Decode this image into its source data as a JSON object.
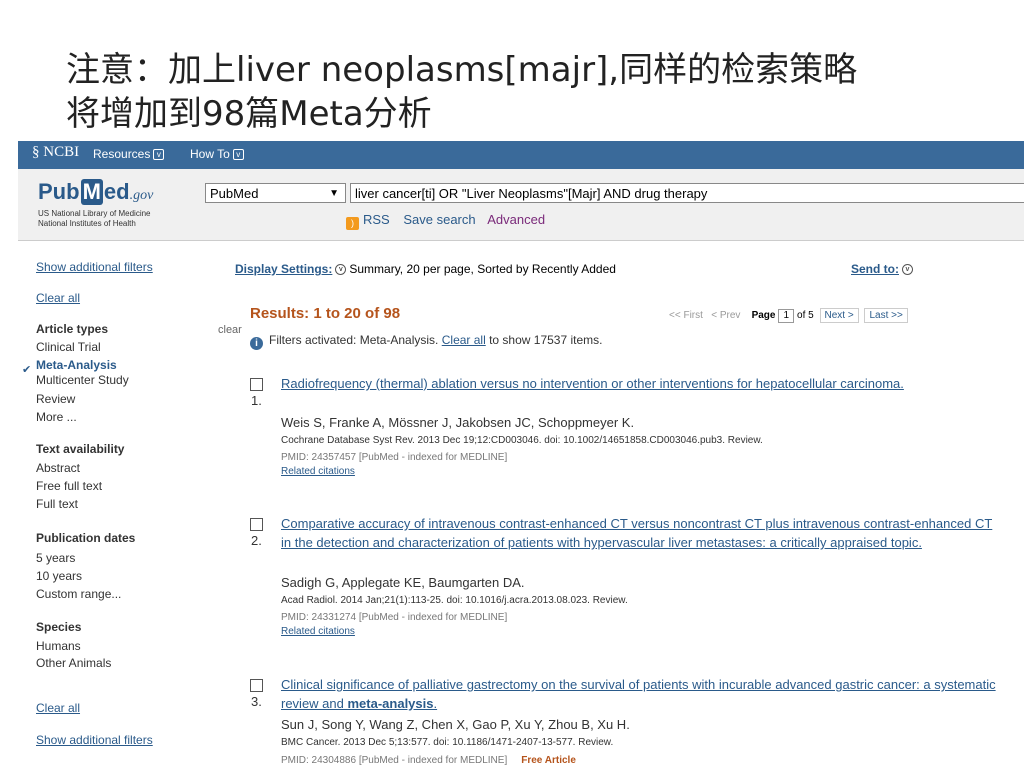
{
  "slide": {
    "title_line1": "注意：加上liver neoplasms[majr],同样的检索策略",
    "title_line2": "将增加到98篇Meta分析"
  },
  "ncbi_bar": {
    "logo": "NCBI",
    "resources": "Resources",
    "howto": "How To"
  },
  "pubmed": {
    "logo_pub": "Pub",
    "logo_m": "M",
    "logo_ed": "ed",
    "logo_gov": ".gov",
    "nlm_line1": "US National Library of Medicine",
    "nlm_line2": "National Institutes of Health",
    "db_selected": "PubMed",
    "query": "liver cancer[ti] OR \"Liver Neoplasms\"[Majr] AND drug therapy",
    "rss": "RSS",
    "save_search": "Save search",
    "advanced": "Advanced"
  },
  "sidebar": {
    "show_filters_top": "Show additional filters",
    "clear_all_top": "Clear all",
    "article_types": "Article types",
    "clear": "clear",
    "types": [
      "Clinical Trial",
      "Meta-Analysis",
      "Multicenter Study",
      "Review",
      "More ..."
    ],
    "text_availability": "Text availability",
    "text_items": [
      "Abstract",
      "Free full text",
      "Full text"
    ],
    "pub_dates": "Publication dates",
    "date_items": [
      "5 years",
      "10 years",
      "Custom range..."
    ],
    "species": "Species",
    "species_items": [
      "Humans",
      "Other Animals"
    ],
    "clear_all_bottom": "Clear all",
    "show_filters_bottom": "Show additional filters"
  },
  "main": {
    "display_settings": "Display Settings:",
    "display_value": "Summary, 20 per page, Sorted by Recently Added",
    "send_to": "Send to:",
    "results": "Results: 1 to 20 of 98",
    "first": "<< First",
    "prev": "< Prev",
    "page_label": "Page",
    "page_value": "1",
    "of_pages": "of 5",
    "next": "Next >",
    "last": "Last >>",
    "filters_text": "Filters activated: Meta-Analysis.",
    "clear_all": "Clear all",
    "filters_tail": "to show 17537 items."
  },
  "results": [
    {
      "num": "1.",
      "title": "Radiofrequency (thermal) ablation versus no intervention or other interventions for hepatocellular carcinoma.",
      "authors": "Weis S, Franke A, Mössner J, Jakobsen JC, Schoppmeyer K.",
      "cite": "Cochrane Database Syst Rev. 2013 Dec 19;12:CD003046. doi: 10.1002/14651858.CD003046.pub3. Review.",
      "pmid": "PMID: 24357457 [PubMed - indexed for MEDLINE]",
      "related": "Related citations"
    },
    {
      "num": "2.",
      "title": "Comparative accuracy of intravenous contrast-enhanced CT versus noncontrast CT plus intravenous contrast-enhanced CT in the detection and characterization of patients with hypervascular liver metastases: a critically appraised topic.",
      "authors": "Sadigh G, Applegate KE, Baumgarten DA.",
      "cite": "Acad Radiol. 2014 Jan;21(1):113-25. doi: 10.1016/j.acra.2013.08.023. Review.",
      "pmid": "PMID: 24331274 [PubMed - indexed for MEDLINE]",
      "related": "Related citations"
    },
    {
      "num": "3.",
      "title_a": "Clinical significance of palliative gastrectomy on the survival of patients with incurable advanced gastric cancer: a systematic review and ",
      "title_b": "meta-analysis",
      "title_c": ".",
      "authors": "Sun J, Song Y, Wang Z, Chen X, Gao P, Xu Y, Zhou B, Xu H.",
      "cite": "BMC Cancer. 2013 Dec 5;13:577. doi: 10.1186/1471-2407-13-577. Review.",
      "pmid": "PMID: 24304886 [PubMed - indexed for MEDLINE]",
      "free": "Free Article"
    }
  ]
}
